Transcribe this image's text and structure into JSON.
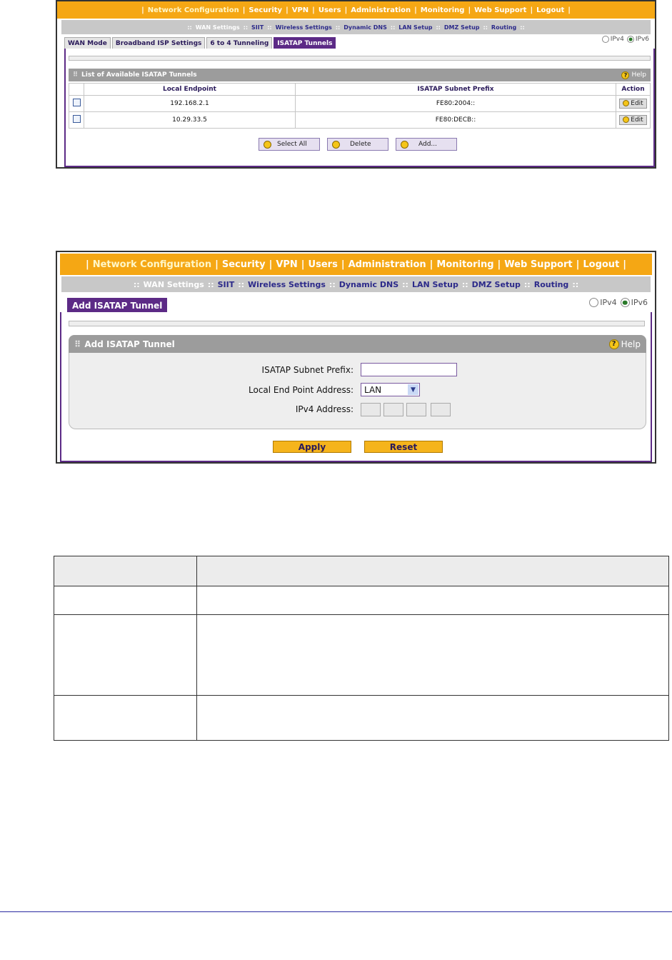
{
  "topnav": {
    "items": [
      "Network Configuration",
      "Security",
      "VPN",
      "Users",
      "Administration",
      "Monitoring",
      "Web Support",
      "Logout"
    ],
    "sep": "|"
  },
  "subnav": {
    "items": [
      "WAN Settings",
      "SIIT",
      "Wireless Settings",
      "Dynamic DNS",
      "LAN Setup",
      "DMZ Setup",
      "Routing"
    ],
    "sep": "::"
  },
  "ipselect": {
    "ipv4": "IPv4",
    "ipv6": "IPv6",
    "selected": "IPv6"
  },
  "screen1": {
    "tabs": [
      "WAN Mode",
      "Broadband ISP Settings",
      "6 to 4 Tunneling",
      "ISATAP Tunnels"
    ],
    "active_tab": "ISATAP Tunnels",
    "section_title": "List of Available ISATAP Tunnels",
    "help_label": "Help",
    "columns": [
      "Local Endpoint",
      "ISATAP Subnet Prefix",
      "Action"
    ],
    "rows": [
      {
        "endpoint": "192.168.2.1",
        "prefix": "FE80:2004::",
        "action": "Edit"
      },
      {
        "endpoint": "10.29.33.5",
        "prefix": "FE80:DECB::",
        "action": "Edit"
      }
    ],
    "buttons": {
      "select_all": "Select All",
      "delete": "Delete",
      "add": "Add..."
    }
  },
  "screen2": {
    "tab": "Add ISATAP Tunnel",
    "section_title": "Add ISATAP Tunnel",
    "help_label": "Help",
    "fields": {
      "prefix_label": "ISATAP Subnet Prefix:",
      "endpoint_label": "Local End Point Address:",
      "endpoint_value": "LAN",
      "ipv4_label": "IPv4 Address:"
    },
    "buttons": {
      "apply": "Apply",
      "reset": "Reset"
    }
  }
}
